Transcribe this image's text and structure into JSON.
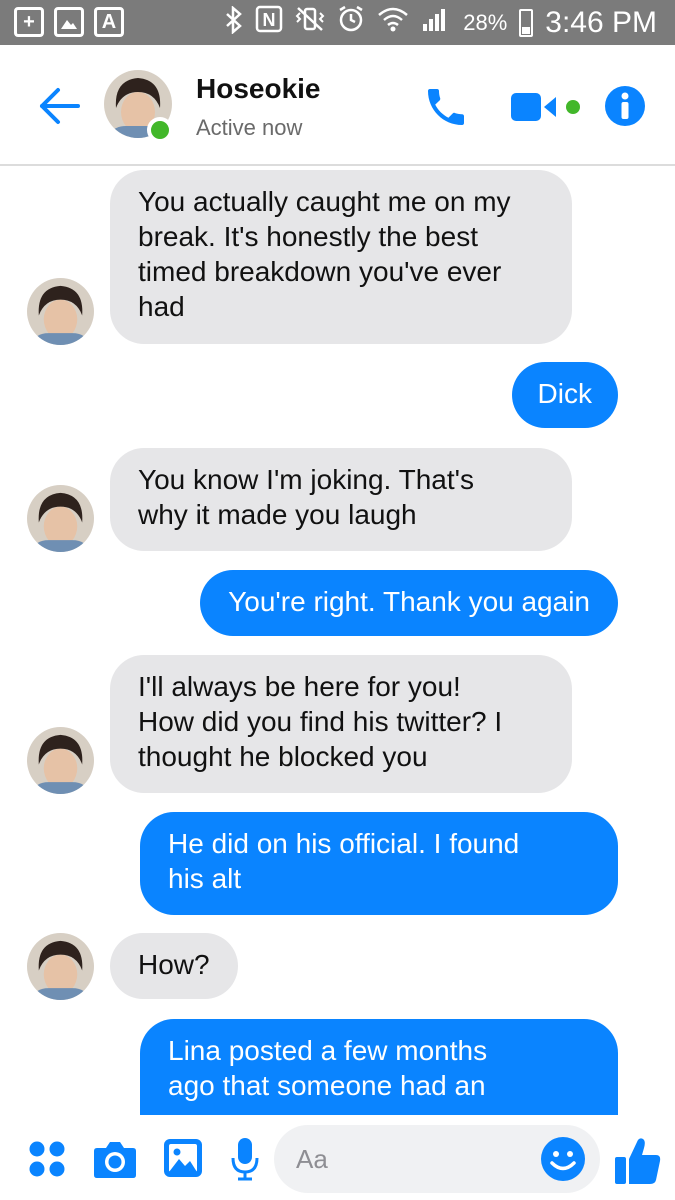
{
  "status_bar": {
    "battery_percent": "28%",
    "time": "3:46 PM",
    "left_icons": [
      "plus-icon",
      "image-icon",
      "font-icon"
    ],
    "right_icons": [
      "bluetooth-icon",
      "nfc-icon",
      "mute-vibrate-icon",
      "alarm-icon",
      "wifi-icon",
      "signal-icon",
      "battery-icon"
    ]
  },
  "header": {
    "contact_name": "Hoseokie",
    "status": "Active now"
  },
  "messages": [
    {
      "side": "in",
      "lines": [
        "You actually caught me on my",
        "break. It's honestly the best",
        "timed breakdown you've ever",
        "had"
      ]
    },
    {
      "side": "out",
      "lines": [
        "Dick"
      ]
    },
    {
      "side": "in",
      "lines": [
        "You know I'm joking. That's",
        "why it made you laugh"
      ]
    },
    {
      "side": "out",
      "lines": [
        "You're right. Thank you again"
      ]
    },
    {
      "side": "in",
      "lines": [
        "I'll always be here for you!",
        "How did you find his twitter? I",
        "thought he blocked you"
      ]
    },
    {
      "side": "out",
      "lines": [
        "He did on his official. I found",
        "his alt"
      ]
    },
    {
      "side": "in",
      "lines": [
        "How?"
      ]
    },
    {
      "side": "out",
      "lines": [
        "Lina posted a few months",
        "ago that someone had an"
      ]
    }
  ],
  "composer": {
    "placeholder": "Aa"
  },
  "colors": {
    "accent": "#0a84ff",
    "incoming_bubble": "#e6e6e8",
    "status_bar": "#7b7b7b",
    "online": "#42b72a"
  }
}
